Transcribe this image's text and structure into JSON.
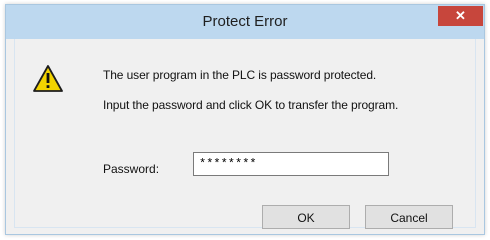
{
  "window": {
    "title": "Protect Error",
    "close_glyph": "✕"
  },
  "dialog": {
    "message_line1": "The user program in the PLC is password protected.",
    "message_line2": "Input the password and click OK to transfer the program.",
    "password_label": "Password:",
    "password_value": "********",
    "ok_label": "OK",
    "cancel_label": "Cancel",
    "icon": "warning-icon"
  },
  "colors": {
    "titlebar": "#bdd8ef",
    "close": "#c7463c",
    "warning": "#f2d300"
  }
}
